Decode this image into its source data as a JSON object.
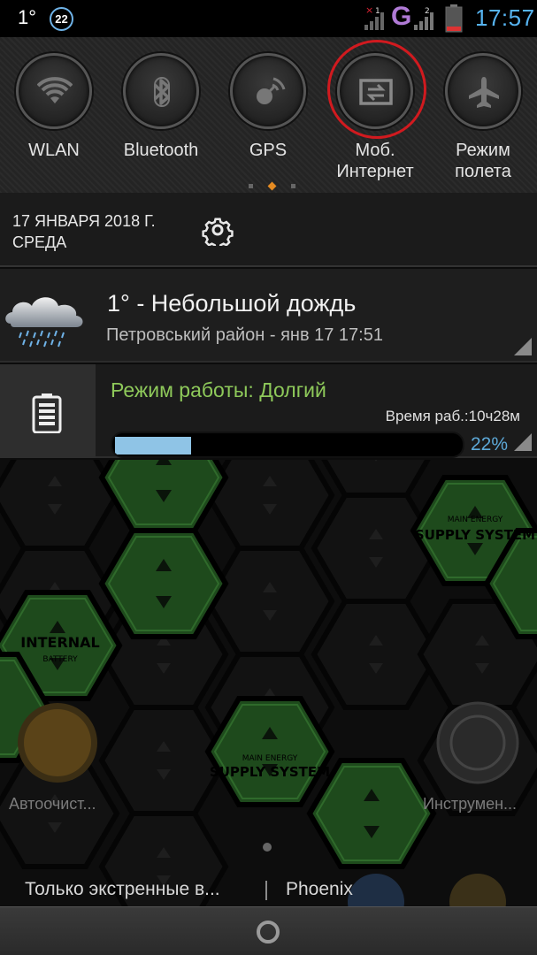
{
  "status_bar": {
    "temperature": "1°",
    "notification_count": "22",
    "network_type": "G",
    "sim1_badge": "1",
    "sim2_badge": "2",
    "time": "17:57",
    "accent_color": "#56b3f0"
  },
  "quick_settings": {
    "tiles": [
      {
        "label": "WLAN",
        "icon": "wifi-icon"
      },
      {
        "label": "Bluetooth",
        "icon": "bluetooth-icon"
      },
      {
        "label": "GPS",
        "icon": "gps-icon"
      },
      {
        "label": "Моб. Интернет",
        "icon": "mobile-data-icon",
        "highlighted": true
      },
      {
        "label": "Режим полета",
        "icon": "airplane-icon"
      }
    ],
    "page_indicator_active": 2
  },
  "date_row": {
    "date": "17 ЯНВАРЯ 2018 Г.",
    "weekday": "СРЕДА",
    "settings_icon": "gear-icon"
  },
  "weather_notification": {
    "title": "1° -  Небольшой дождь",
    "subtitle": "Петровський район - янв 17  17:51",
    "icon": "rain-cloud-icon"
  },
  "battery_notification": {
    "mode": "Режим работы: Долгий",
    "runtime": "Время раб.:10ч28м",
    "percent_label": "22%",
    "level": 0.22,
    "accent_color": "#8ec95a"
  },
  "home_screen": {
    "hex_labels": [
      "MAIN ENERGY",
      "SUPPLY SYSTEM",
      "INTERNAL",
      "BATTERY",
      "MAIN ENERGY",
      "SUPPLY SYSTEM"
    ],
    "app_left": "Автоочист...",
    "app_right": "Инструмен...",
    "bottom_left": "Только экстренные в...",
    "bottom_right": "Phoenix"
  }
}
